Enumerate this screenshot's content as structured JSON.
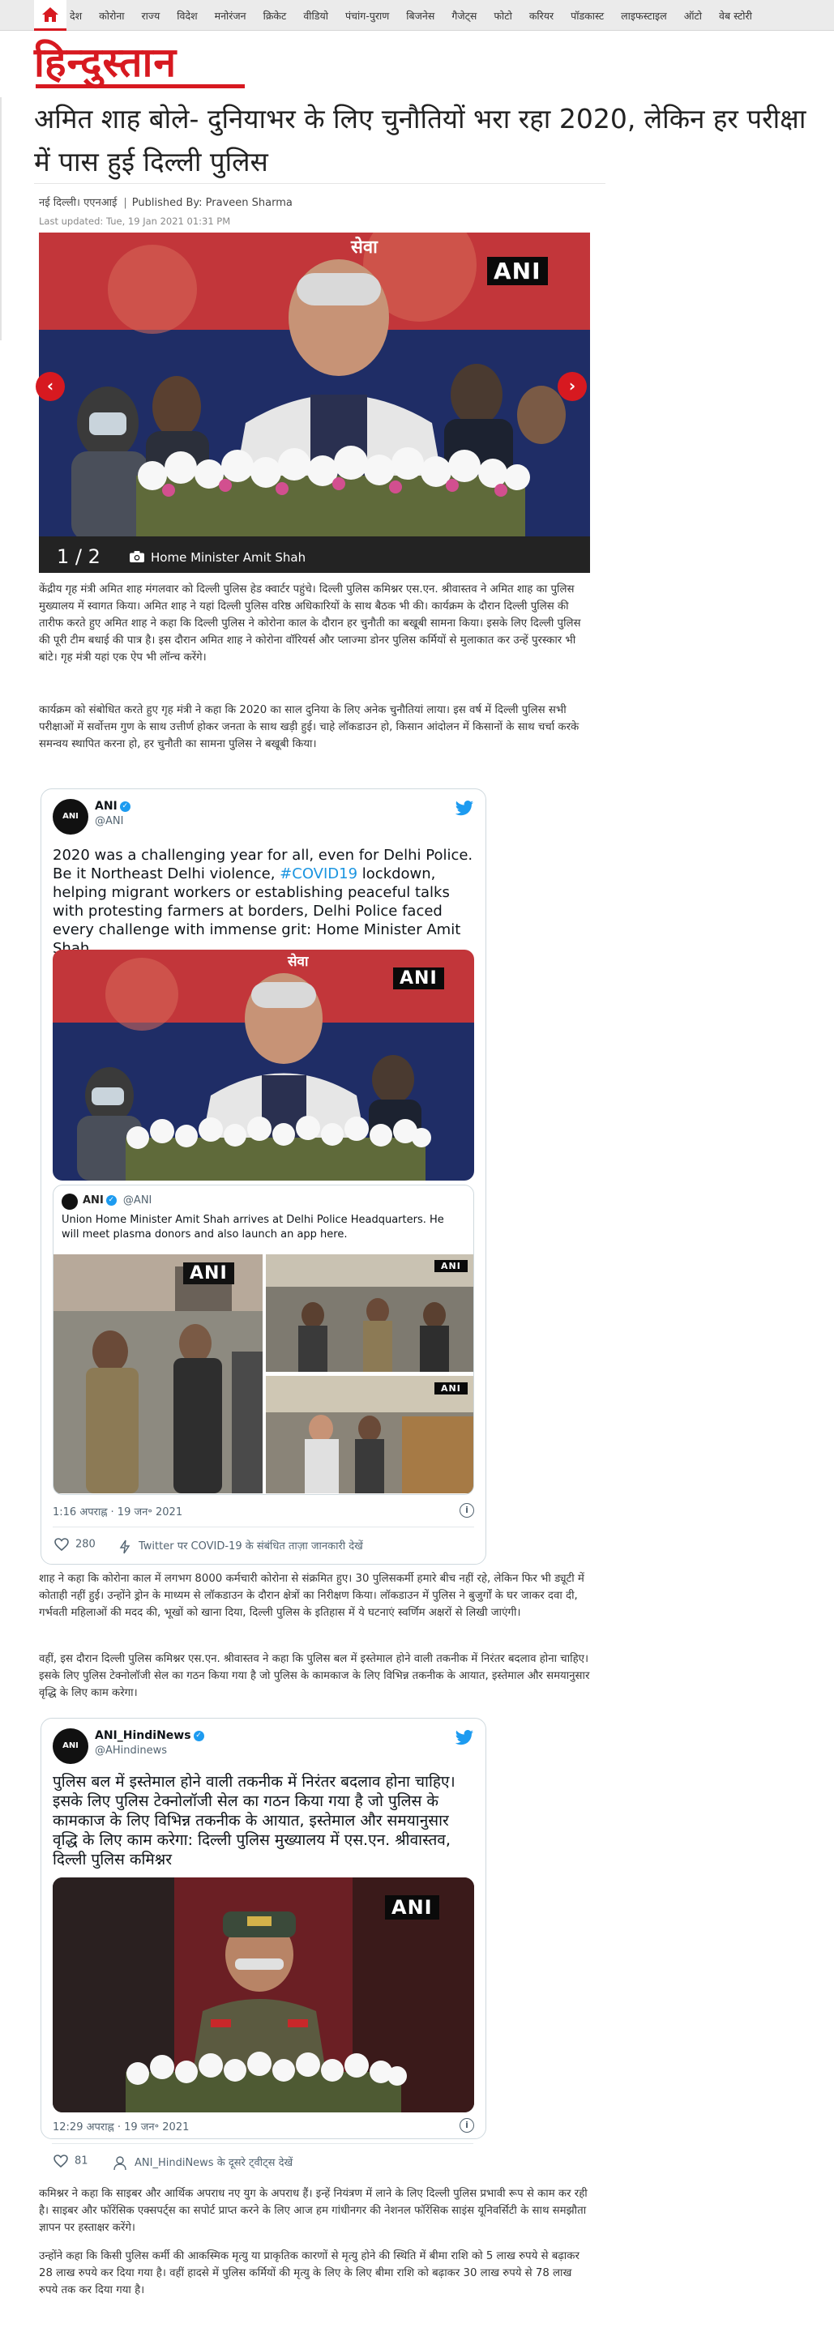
{
  "nav": {
    "home_icon": "home-icon",
    "items": [
      "देश",
      "कोरोना",
      "राज्य",
      "विदेश",
      "मनोरंजन",
      "क्रिकेट",
      "वीडियो",
      "पंचांग-पुराण",
      "बिजनेस",
      "गैजेट्स",
      "फोटो",
      "करियर",
      "पॉडकास्ट",
      "लाइफस्टाइल",
      "ऑटो",
      "वेब स्टोरी"
    ]
  },
  "logo": "हिन्दुस्तान",
  "colors": {
    "brand": "#d71920",
    "twitter": "#1d9bf0",
    "link": "#1b95e0"
  },
  "article": {
    "headline": "अमित शाह बोले- दुनियाभर के लिए चुनौतियों भरा रहा 2020, लेकिन हर परीक्षा में पास हुई दिल्ली पुलिस",
    "location": "नई दिल्ली। एएनआई",
    "published_by": "Published By: Praveen Sharma",
    "last_updated": "Last updated: Tue, 19 Jan 2021 01:31 PM",
    "slideshow": {
      "counter": "1 / 2",
      "caption": "Home Minister Amit Shah",
      "watermark": "ANI",
      "banner_text": "सेवा"
    },
    "paragraphs": [
      "केंद्रीय गृह मंत्री अमित शाह मंगलवार को दिल्ली पुलिस हेड क्वार्टर पहुंचे। दिल्ली पुलिस कमिश्नर एस.एन. श्रीवास्तव ने अमित शाह का पुलिस मुख्यालय में स्वागत किया। अमित शाह ने यहां दिल्ली पुलिस वरिष्ठ अधिकारियों के साथ बैठक भी की। कार्यक्रम के दौरान दिल्ली पुलिस की तारीफ करते हुए अमित शाह ने कहा कि दिल्ली पुलिस ने कोरोना काल के दौरान हर चुनौती का बखूबी सामना किया। इसके लिए दिल्ली पुलिस की पूरी टीम बधाई की पात्र है। इस दौरान अमित शाह ने कोरोना वॉरियर्स और प्लाज्मा डोनर पुलिस कर्मियों से मुलाकात कर उन्हें पुरस्कार भी बांटे। गृह मंत्री यहां एक ऐप भी लॉन्च करेंगे।",
      "कार्यक्रम को संबोधित करते हुए गृह मंत्री ने कहा कि 2020 का साल दुनिया के लिए अनेक चुनौतियां लाया। इस वर्ष में दिल्ली पुलिस सभी परीक्षाओं में सर्वोत्तम गुण के साथ उत्तीर्ण होकर जनता के साथ खड़ी हुई। चाहे लॉकडाउन हो, किसान आंदोलन में किसानों के साथ चर्चा करके समन्वय स्थापित करना हो, हर चुनौती का सामना पुलिस ने बखूबी किया।",
      "शाह ने कहा कि कोरोना काल में लगभग 8000 कर्मचारी कोरोना से संक्रमित हुए। 30 पुलिसकर्मी हमारे बीच नहीं रहे, लेकिन फिर भी ड्यूटी में कोताही नहीं हुई। उन्होंने ड्रोन के माध्यम से लॉकडाउन के दौरान क्षेत्रों का निरीक्षण किया। लॉकडाउन में पुलिस ने बुजुर्गों के घर जाकर दवा दी, गर्भवती महिलाओं की मदद की, भूखों को खाना दिया, दिल्ली पुलिस के इतिहास में ये घटनाएं स्वर्णिम अक्षरों से लिखी जाएंगी।",
      "वहीं, इस दौरान दिल्ली पुलिस कमिश्नर एस.एन. श्रीवास्तव ने कहा कि पुलिस बल में इस्तेमाल होने वाली तकनीक में निरंतर बदलाव होना चाहिए। इसके लिए पुलिस टेक्नोलॉजी सेल का गठन किया गया है जो पुलिस के कामकाज के लिए विभिन्न तकनीक के आयात, इस्तेमाल और समयानुसार वृद्धि के लिए काम करेगा।",
      "कमिश्नर ने कहा कि साइबर और आर्थिक अपराध नए युग के अपराध हैं। इन्हें नियंत्रण में लाने के लिए दिल्ली पुलिस प्रभावी रूप से काम कर रही है। साइबर और फॉरेंसिक एक्सपर्ट्स का सपोर्ट प्राप्त करने के लिए आज हम गांधीनगर की नेशनल फॉरेंसिक साइंस यूनिवर्सिटी के साथ समझौता ज्ञापन पर हस्ताक्षर करेंगे।",
      "उन्होंने कहा कि किसी पुलिस कर्मी की आकस्मिक मृत्यु या प्राकृतिक कारणों से मृत्यु होने की स्थिति में बीमा राशि को 5 लाख रुपये से बढ़ाकर 28 लाख रुपये कर दिया गया है। वहीं हादसे में पुलिस कर्मियों की मृत्यु के लिए के लिए बीमा राशि को बढ़ाकर 30 लाख रुपये से 78 लाख रुपये तक कर दिया गया है।"
    ]
  },
  "tweet1": {
    "avatar_text": "ANI",
    "name": "ANI",
    "handle": "@ANI",
    "text_before_link": "2020 was a challenging year for all, even for Delhi Police. Be it Northeast Delhi violence, ",
    "hashtag": "#COVID19",
    "text_after_link": " lockdown, helping migrant workers or establishing peaceful talks with protesting farmers at borders, Delhi Police faced every challenge with immense grit: Home Minister Amit Shah",
    "media_watermark": "ANI",
    "media_banner_text": "सेवा",
    "quote": {
      "name": "ANI",
      "handle": "@ANI",
      "text": "Union Home Minister Amit Shah arrives at Delhi Police Headquarters. He will meet plasma donors and also launch an app here.",
      "watermark": "ANI"
    },
    "time": "1:16 अपराह्न · 19 जन॰ 2021",
    "likes": "280",
    "covid_link": "Twitter पर COVID-19 के संबंधित ताज़ा जानकारी देखें",
    "info_icon": "info-icon",
    "heart_icon": "heart-icon",
    "bolt_icon": "bolt-icon"
  },
  "tweet2": {
    "avatar_text": "ANI",
    "name": "ANI_HindiNews",
    "handle": "@AHindinews",
    "text": "पुलिस बल में इस्तेमाल होने वाली तकनीक में निरंतर बदलाव होना चाहिए। इसके लिए पुलिस टेक्नोलॉजी सेल का गठन किया गया है जो पुलिस के कामकाज के लिए विभिन्न तकनीक के आयात, इस्तेमाल और समयानुसार वृद्धि के लिए काम करेगा: दिल्ली पुलिस मुख्यालय में एस.एन. श्रीवास्तव, दिल्ली पुलिस कमिश्नर",
    "media_watermark": "ANI",
    "time": "12:29 अपराह्न · 19 जन॰ 2021",
    "likes": "81",
    "other_tweets_link": "ANI_HindiNews के दूसरे ट्वीट्स देखें"
  }
}
